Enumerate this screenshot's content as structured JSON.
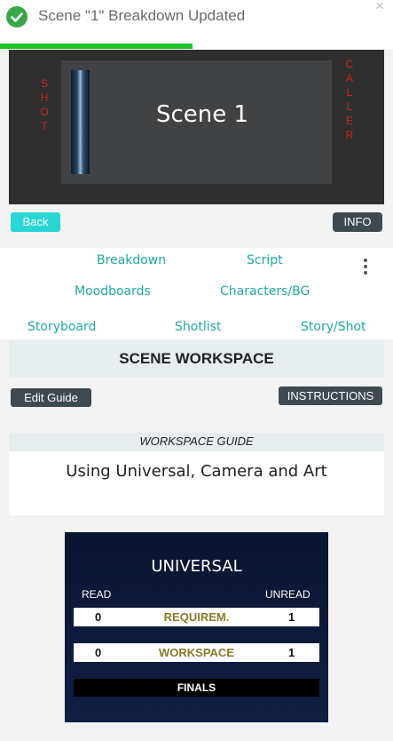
{
  "toast": {
    "message": "Scene \"1\" Breakdown Updated",
    "close": "×",
    "progress": 0.49
  },
  "header": {
    "left_vertical": [
      "S",
      "H",
      "O",
      "T"
    ],
    "right_vertical": [
      "C",
      "A",
      "L",
      "L",
      "E",
      "R"
    ],
    "scene_title": "Scene 1"
  },
  "buttons": {
    "back": "Back",
    "info": "INFO",
    "edit_guide": "Edit Guide",
    "instructions": "INSTRUCTIONS"
  },
  "nav": {
    "row1": [
      "Breakdown",
      "Script"
    ],
    "row2": [
      "Moodboards",
      "Characters/BG"
    ],
    "row3": [
      "Storyboard",
      "Shotlist",
      "Story/Shot"
    ]
  },
  "workspace": {
    "title": "SCENE WORKSPACE"
  },
  "guide": {
    "header": "WORKSPACE GUIDE",
    "title": "Using Universal, Camera and Art"
  },
  "universal": {
    "title": "UNIVERSAL",
    "read_label": "READ",
    "unread_label": "UNREAD",
    "rows": [
      {
        "read": "0",
        "label": "REQUIREM.",
        "unread": "1"
      },
      {
        "read": "0",
        "label": "WORKSPACE",
        "unread": "1"
      }
    ],
    "finals": "FINALS"
  },
  "colors": {
    "accent_teal": "#1fa9a3",
    "back_button": "#2ad6d3",
    "shot_caller_red": "#d62020",
    "toast_green": "#1fc32b"
  }
}
